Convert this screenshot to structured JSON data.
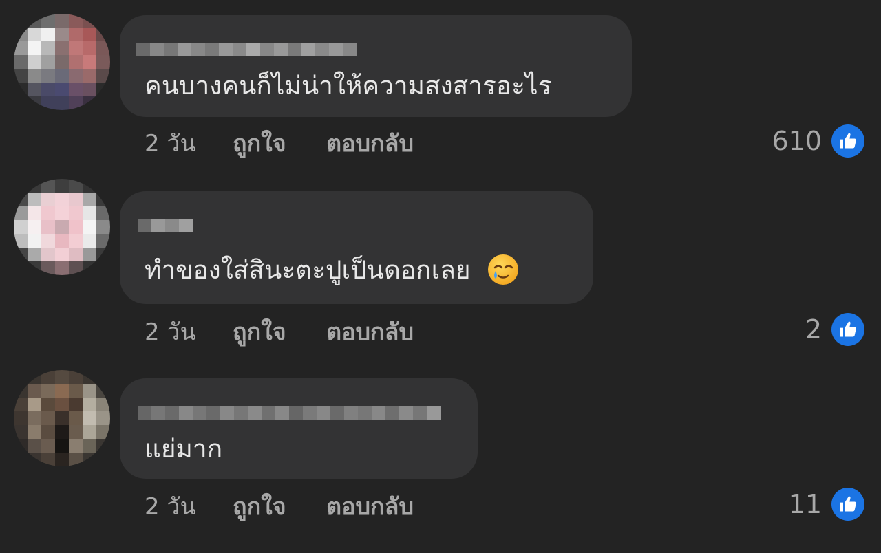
{
  "colors": {
    "background": "#232323",
    "bubble": "#333334",
    "like_blue": "#1b74e4"
  },
  "comments": [
    {
      "author": "[blurred]",
      "text": "คนบางคนก็ไม่น่าให้ความสงสารอะไร",
      "emoji": "",
      "time": "2 วัน",
      "like_label": "ถูกใจ",
      "reply_label": "ตอบกลับ",
      "like_count": "610",
      "reaction_icon": "thumbs-up-icon"
    },
    {
      "author": "[blurred]",
      "text": "ทำของใส่สินะตะปูเป็นดอกเลย",
      "emoji": "smiling-face-with-tear-emoji",
      "time": "2 วัน",
      "like_label": "ถูกใจ",
      "reply_label": "ตอบกลับ",
      "like_count": "2",
      "reaction_icon": "thumbs-up-icon"
    },
    {
      "author": "[blurred]",
      "text": "แย่มาก",
      "emoji": "",
      "time": "2 วัน",
      "like_label": "ถูกใจ",
      "reply_label": "ตอบกลับ",
      "like_count": "11",
      "reaction_icon": "thumbs-up-icon"
    }
  ]
}
